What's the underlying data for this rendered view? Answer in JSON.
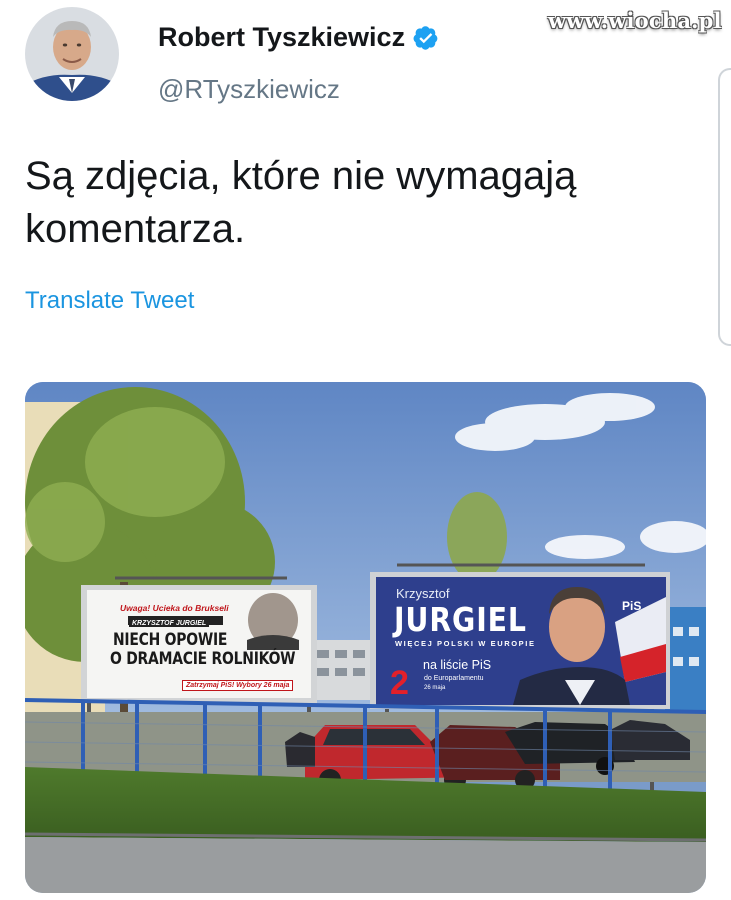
{
  "watermark": {
    "text": "www.wiocha.pl"
  },
  "author": {
    "display_name": "Robert Tyszkiewicz",
    "handle": "@RTyszkiewicz",
    "verified": true
  },
  "tweet": {
    "text_line1": "Są zdjęcia, które nie wymagają",
    "text_line2": "komentarza.",
    "translate_label": "Translate Tweet"
  },
  "billboard_left": {
    "warning": "Uwaga! Ucieka do Brukseli",
    "name": "KRZYSZTOF JURGIEL",
    "headline_line1": "NIECH OPOWIE",
    "headline_line2": "O DRAMACIE ROLNIKÓW",
    "footer": "Zatrzymaj PiS! Wybory 26 maja"
  },
  "billboard_right": {
    "first_name": "Krzysztof",
    "last_name": "JURGIEL",
    "slogan": "WIĘCEJ POLSKI W EUROPIE",
    "list_number": "2",
    "list_text": "na liście PiS",
    "election": "do Europarlamentu",
    "date": "26 maja",
    "party": "PiS"
  },
  "colors": {
    "link": "#1b95e0",
    "verified": "#1da1f2",
    "handle": "#657786",
    "text": "#14171a"
  }
}
